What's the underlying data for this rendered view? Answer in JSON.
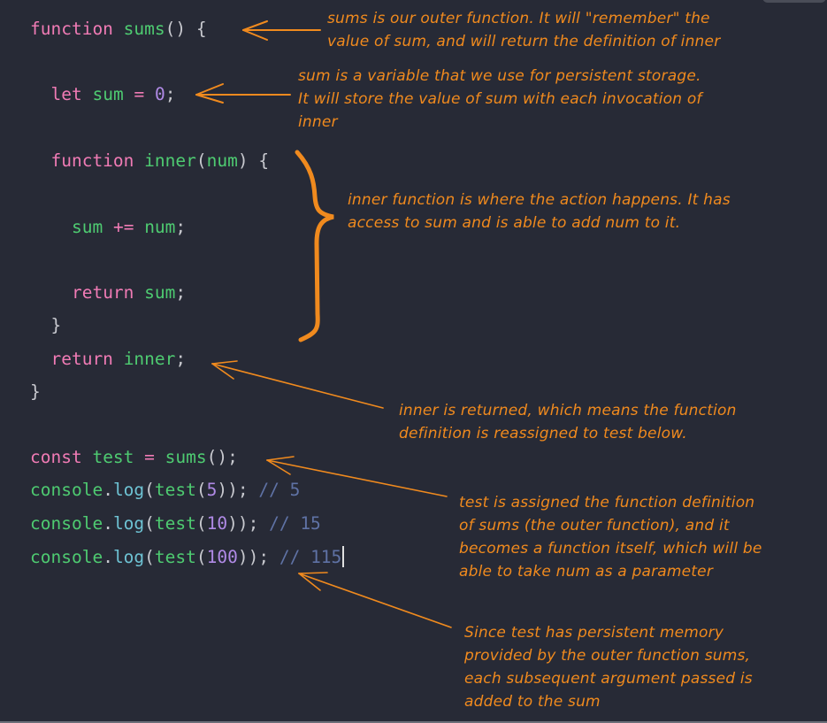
{
  "code": {
    "lines": [
      {
        "tokens": [
          {
            "t": "function",
            "c": "kw"
          },
          {
            "t": " "
          },
          {
            "t": "sums",
            "c": "fn"
          },
          {
            "t": "() {",
            "c": "pn"
          }
        ]
      },
      {
        "tokens": [
          {
            "t": "  "
          },
          {
            "t": "let",
            "c": "kw"
          },
          {
            "t": " "
          },
          {
            "t": "sum",
            "c": "fn"
          },
          {
            "t": " "
          },
          {
            "t": "=",
            "c": "op"
          },
          {
            "t": " "
          },
          {
            "t": "0",
            "c": "num"
          },
          {
            "t": ";",
            "c": "pn"
          }
        ]
      },
      {
        "tokens": [
          {
            "t": "  "
          },
          {
            "t": "function",
            "c": "kw"
          },
          {
            "t": " "
          },
          {
            "t": "inner",
            "c": "fn"
          },
          {
            "t": "(",
            "c": "pn"
          },
          {
            "t": "num",
            "c": "fn"
          },
          {
            "t": ") {",
            "c": "pn"
          }
        ]
      },
      {
        "tokens": [
          {
            "t": "    "
          },
          {
            "t": "sum",
            "c": "fn"
          },
          {
            "t": " "
          },
          {
            "t": "+=",
            "c": "op"
          },
          {
            "t": " "
          },
          {
            "t": "num",
            "c": "fn"
          },
          {
            "t": ";",
            "c": "pn"
          }
        ]
      },
      {
        "tokens": [
          {
            "t": "    "
          },
          {
            "t": "return",
            "c": "kw"
          },
          {
            "t": " "
          },
          {
            "t": "sum",
            "c": "fn"
          },
          {
            "t": ";",
            "c": "pn"
          }
        ]
      },
      {
        "tokens": [
          {
            "t": "  "
          },
          {
            "t": "}",
            "c": "pn"
          }
        ]
      },
      {
        "tokens": [
          {
            "t": "  "
          },
          {
            "t": "return",
            "c": "kw"
          },
          {
            "t": " "
          },
          {
            "t": "inner",
            "c": "fn"
          },
          {
            "t": ";",
            "c": "pn"
          }
        ]
      },
      {
        "tokens": [
          {
            "t": "}",
            "c": "pn"
          }
        ]
      },
      {
        "tokens": [
          {
            "t": "const",
            "c": "kw"
          },
          {
            "t": " "
          },
          {
            "t": "test",
            "c": "fn"
          },
          {
            "t": " "
          },
          {
            "t": "=",
            "c": "op"
          },
          {
            "t": " "
          },
          {
            "t": "sums",
            "c": "fn"
          },
          {
            "t": "();",
            "c": "pn"
          }
        ]
      },
      {
        "tokens": [
          {
            "t": "console",
            "c": "fn"
          },
          {
            "t": ".",
            "c": "pn"
          },
          {
            "t": "log",
            "c": "prop"
          },
          {
            "t": "(",
            "c": "pn"
          },
          {
            "t": "test",
            "c": "fn"
          },
          {
            "t": "(",
            "c": "pn"
          },
          {
            "t": "5",
            "c": "num"
          },
          {
            "t": "));",
            "c": "pn"
          },
          {
            "t": " // 5",
            "c": "cm"
          }
        ]
      },
      {
        "tokens": [
          {
            "t": "console",
            "c": "fn"
          },
          {
            "t": ".",
            "c": "pn"
          },
          {
            "t": "log",
            "c": "prop"
          },
          {
            "t": "(",
            "c": "pn"
          },
          {
            "t": "test",
            "c": "fn"
          },
          {
            "t": "(",
            "c": "pn"
          },
          {
            "t": "10",
            "c": "num"
          },
          {
            "t": "));",
            "c": "pn"
          },
          {
            "t": " // 15",
            "c": "cm"
          }
        ]
      },
      {
        "tokens": [
          {
            "t": "console",
            "c": "fn"
          },
          {
            "t": ".",
            "c": "pn"
          },
          {
            "t": "log",
            "c": "prop"
          },
          {
            "t": "(",
            "c": "pn"
          },
          {
            "t": "test",
            "c": "fn"
          },
          {
            "t": "(",
            "c": "pn"
          },
          {
            "t": "100",
            "c": "num"
          },
          {
            "t": "));",
            "c": "pn"
          },
          {
            "t": " // 115",
            "c": "cm"
          }
        ]
      }
    ]
  },
  "annotations": {
    "sums_note": [
      "sums is our outer function.  It will \"remember\" the",
      "value of sum, and will return the definition of inner"
    ],
    "sum_note": [
      "sum is a variable that we use for persistent storage.",
      "It will store the value of sum with each invocation of",
      "inner"
    ],
    "inner_note": [
      "inner function is where the action happens.  It has",
      "access to sum and is able to add num to it."
    ],
    "return_note": [
      "inner is returned, which means the function",
      "definition is reassigned to test below."
    ],
    "test_note": [
      "test is assigned the function definition",
      "of sums (the outer function), and it",
      "becomes a function itself, which will be",
      "able to take num as a parameter"
    ],
    "memory_note": [
      "Since test has persistent memory",
      "provided by the outer function sums,",
      "each subsequent argument passed is",
      "added to the sum"
    ]
  },
  "colors": {
    "background": "#272a36",
    "annotation": "#f08a1e",
    "keyword": "#f07bb5",
    "identifier": "#4ecb71",
    "number": "#b08ae6",
    "comment": "#5f72a5"
  }
}
